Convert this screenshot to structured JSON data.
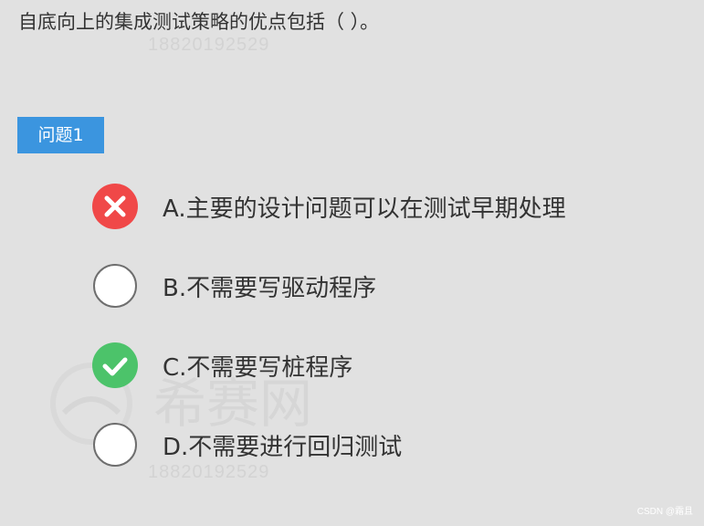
{
  "question": {
    "text": "自底向上的集成测试策略的优点包括（  ）。"
  },
  "question_tag": {
    "label": "问题1"
  },
  "options": [
    {
      "label": "A.主要的设计问题可以在测试早期处理",
      "state": "wrong",
      "icon": "x-circle-icon",
      "color": "#f04848"
    },
    {
      "label": "B.不需要写驱动程序",
      "state": "unselected",
      "icon": "empty-circle"
    },
    {
      "label": "C.不需要写桩程序",
      "state": "correct",
      "icon": "check-circle-icon",
      "color": "#4cc36a"
    },
    {
      "label": "D.不需要进行回归测试",
      "state": "unselected",
      "icon": "empty-circle"
    }
  ],
  "watermark": {
    "number": "18820192529",
    "site": "希赛网"
  },
  "footer": {
    "credit": "CSDN @霜且"
  },
  "colors": {
    "background": "#e1e1e1",
    "tag": "#3b95df",
    "wrong": "#f04848",
    "correct": "#4cc36a"
  }
}
